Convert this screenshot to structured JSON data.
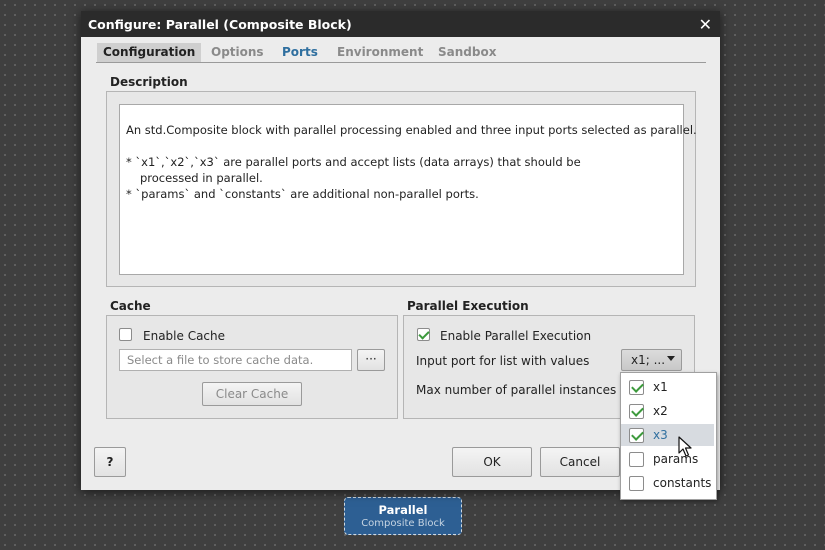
{
  "dialog": {
    "title": "Configure: Parallel (Composite Block)",
    "close_glyph": "✕",
    "tabs": [
      {
        "label": "Configuration"
      },
      {
        "label": "Options"
      },
      {
        "label": "Ports"
      },
      {
        "label": "Environment"
      },
      {
        "label": "Sandbox"
      }
    ],
    "description": {
      "title": "Description",
      "lines": [
        "An std.Composite block with parallel processing enabled and three input ports selected as parallel.",
        "* `x1`,`x2`,`x3` are parallel ports and accept lists (data arrays) that should be",
        "processed in parallel.",
        "* `params` and `constants` are additional non-parallel ports."
      ]
    },
    "cache": {
      "title": "Cache",
      "enable_label": "Enable Cache",
      "enabled": false,
      "file_placeholder": "Select a file to store cache data.",
      "browse_label": "···",
      "clear_label": "Clear Cache"
    },
    "parallel": {
      "title": "Parallel Execution",
      "enable_label": "Enable Parallel Execution",
      "enabled": true,
      "input_port_label": "Input port for list with values",
      "input_port_value": "x1; ...",
      "max_instances_label": "Max number of parallel instances"
    },
    "help_label": "?",
    "ok_label": "OK",
    "cancel_label": "Cancel"
  },
  "dropdown_popup": {
    "items": [
      {
        "label": "x1",
        "checked": true
      },
      {
        "label": "x2",
        "checked": true
      },
      {
        "label": "x3",
        "checked": true
      },
      {
        "label": "params",
        "checked": false
      },
      {
        "label": "constants",
        "checked": false
      }
    ],
    "highlighted": "x3"
  },
  "canvas_block": {
    "name": "Parallel",
    "type": "Composite Block"
  }
}
